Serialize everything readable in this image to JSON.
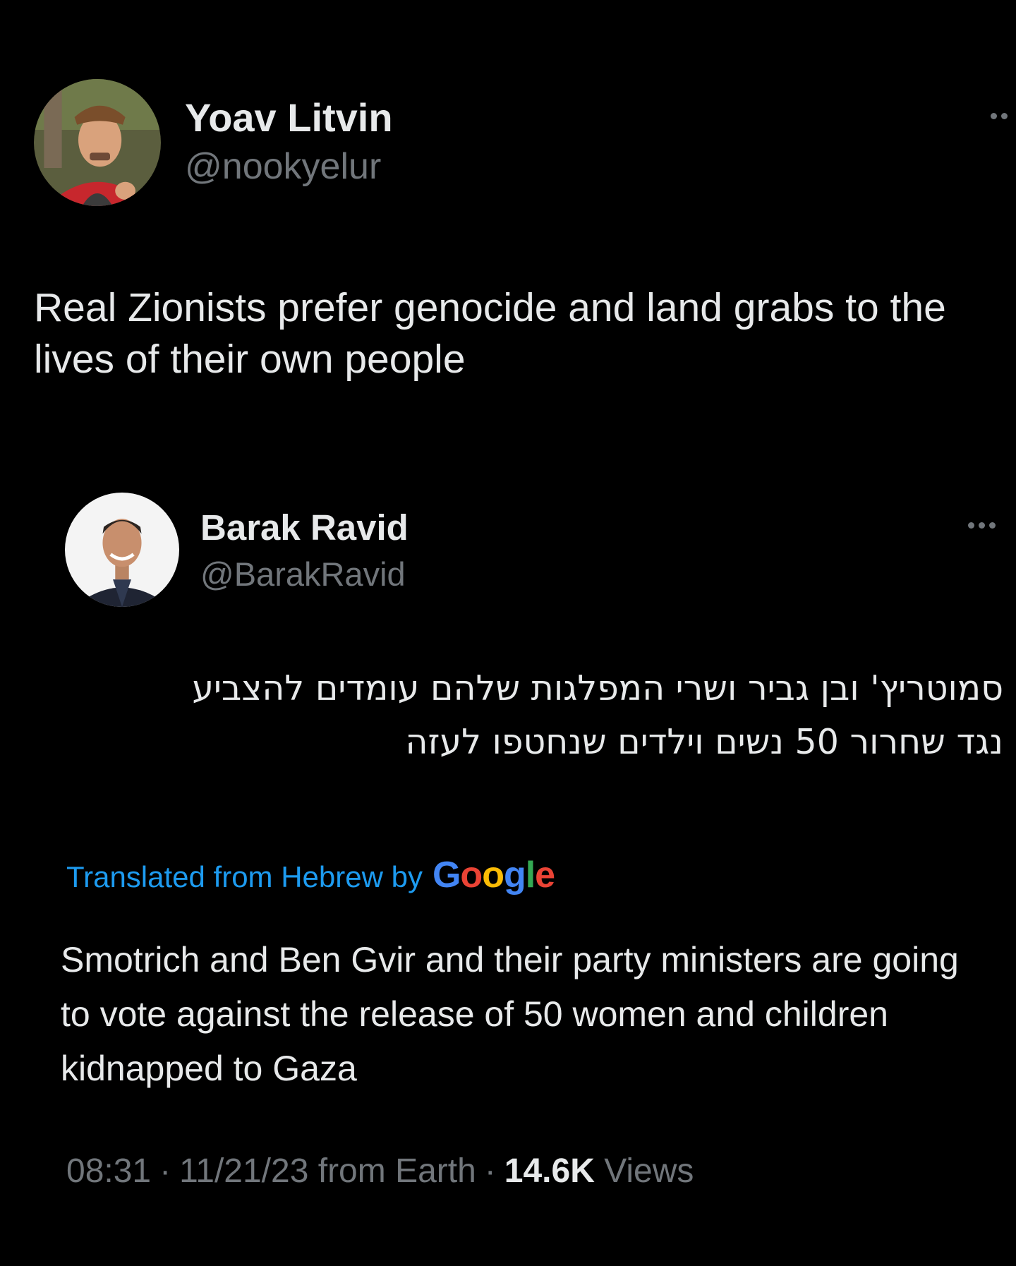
{
  "author": {
    "display_name": "Yoav Litvin",
    "handle": "@nookyelur",
    "avatar_icon": "user-avatar-icon"
  },
  "tweet": {
    "text": "Real Zionists prefer genocide and land grabs to the lives of their own people"
  },
  "quoted": {
    "display_name": "Barak Ravid",
    "handle": "@BarakRavid",
    "avatar_icon": "user-avatar-icon",
    "original_text_line1": "סמוטריץ' ובן גביר ושרי המפלגות שלהם עומדים להצביע",
    "original_text_line2": "נגד שחרור 50 נשים וילדים שנחטפו לעזה",
    "translated_label": "Translated from Hebrew by",
    "translator_logo": {
      "letters": [
        "G",
        "o",
        "o",
        "g",
        "l",
        "e"
      ],
      "colors": [
        "#4285F4",
        "#EA4335",
        "#FBBC05",
        "#4285F4",
        "#34A853",
        "#EA4335"
      ]
    },
    "translation": "Smotrich and Ben Gvir and their party ministers are going to vote against the release of 50 women and children kidnapped to Gaza",
    "time": "08:31",
    "date": "11/21/23",
    "source": "from Earth",
    "separator": "·",
    "views_count": "14.6K",
    "views_label": "Views"
  },
  "more_icon": "more-horizontal-icon",
  "colors": {
    "background": "#000000",
    "primary_text": "#e7e9ea",
    "secondary_text": "#71767b",
    "link": "#1d9bf0"
  }
}
